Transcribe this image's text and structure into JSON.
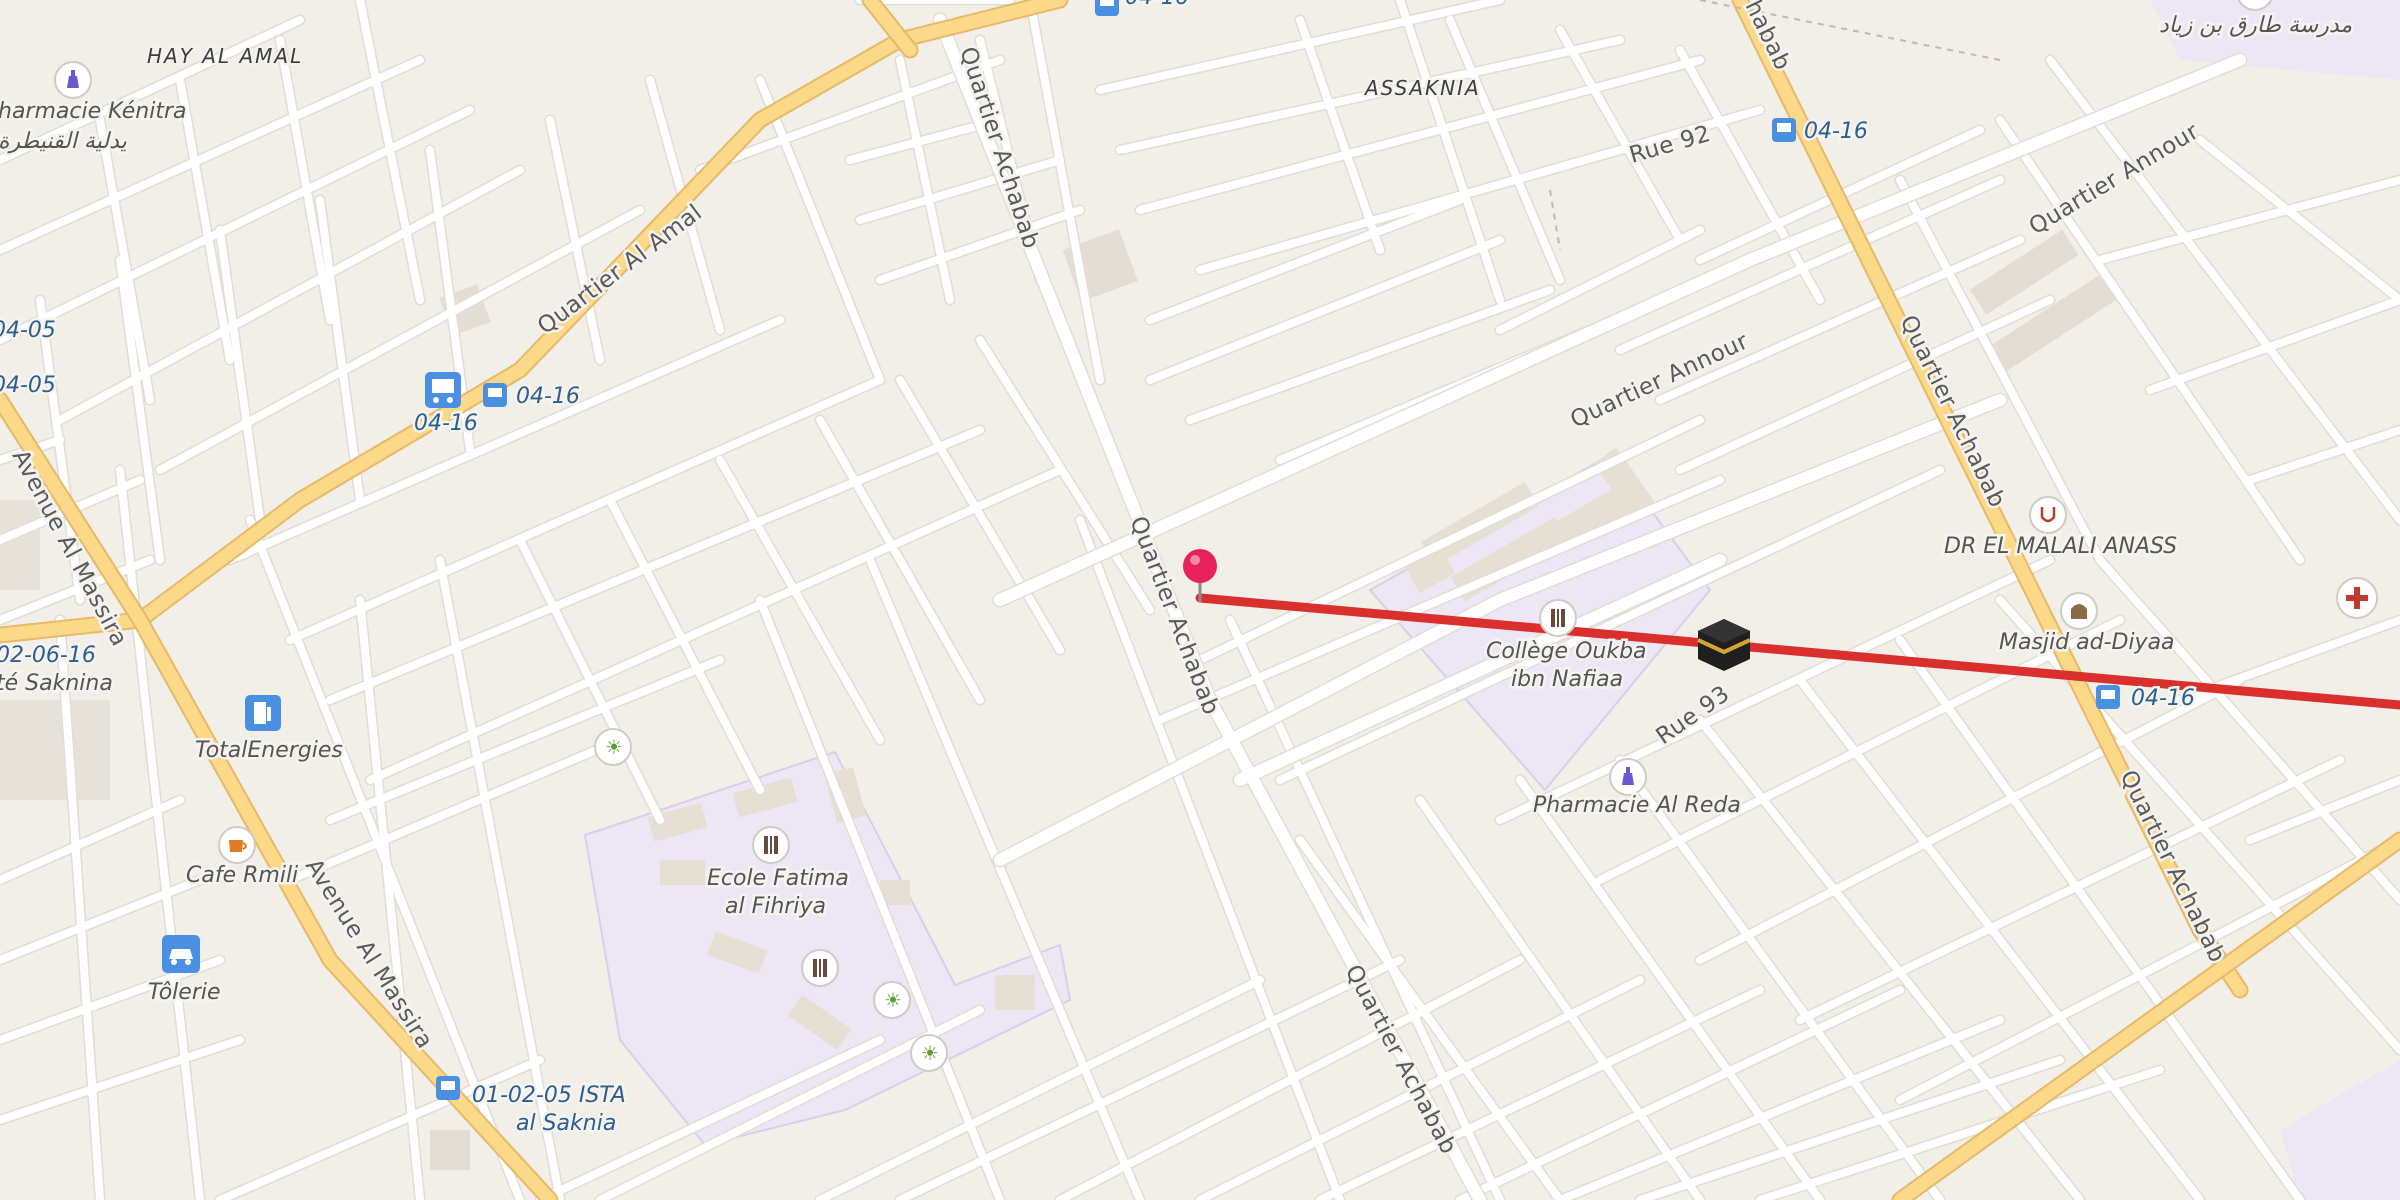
{
  "colors": {
    "background": "#f2efe9",
    "road_minor": "#ffffff",
    "road_main": "#fcd889",
    "school_area": "#ece6f5",
    "route_line": "#d9302e",
    "pin": "#e8215b",
    "bus_icon": "#4a90e2"
  },
  "areas": {
    "hay_al_amal": "HAY AL AMAL",
    "assaknia": "ASSAKNIA"
  },
  "streets": {
    "quartier_al_amal": "Quartier Al Amal",
    "avenue_al_massira_1": "Avenue Al Massira",
    "avenue_al_massira_2": "Avenue Al Massira",
    "quartier_achabab_1": "Quartier Achabab",
    "quartier_achabab_2": "Quartier Achabab",
    "quartier_achabab_3": "Quartier Achabab",
    "quartier_achabab_4": "Quartier Achabab",
    "quartier_achabab_5": "Quartier Achabab",
    "achabab_top": "habab",
    "quartier_annour_1": "Quartier Annour",
    "quartier_annour_2": "Quartier Annour",
    "rue_92": "Rue 92",
    "rue_93": "Rue 93"
  },
  "pois": {
    "pharmacie_kenitra": "harmacie Kénitra",
    "pharmacie_kenitra_ar": "يدلية القنيطرة",
    "madrasa_tariq": "مدرسة طارق بن زياد",
    "total_energies": "TotalEnergies",
    "cafe_rmili": "Cafe Rmili",
    "tolerie": "Tôlerie",
    "ecole_fatima_1": "Ecole Fatima",
    "ecole_fatima_2": "al Fihriya",
    "college_oukba_1": "Collège Oukba",
    "college_oukba_2": "ibn Nafiaa",
    "pharmacie_al_reda": "Pharmacie Al Reda",
    "dr_el_malali": "DR EL MALALI ANASS",
    "masjid_ad_diyaa": "Masjid ad-Diyaa",
    "cite_saknina": "té Saknina"
  },
  "bus_stops": {
    "top_center": "04-16",
    "right_top": "04-16",
    "left_a": "04-05",
    "left_b": "04-05",
    "left_c": "04-16",
    "left_d": "04-16",
    "left_e": "02-06-16",
    "ista_1": "01-02-05 ISTA",
    "ista_2": "al Saknia",
    "right_mid": "04-16"
  },
  "icons": {
    "pin": "map-pin-icon",
    "kaaba": "kaaba-icon",
    "bus": "bus-stop-icon",
    "fuel": "fuel-station-icon",
    "cafe": "cafe-icon",
    "car_repair": "car-repair-icon",
    "school": "school-icon",
    "sport": "sports-icon",
    "pharmacy": "pharmacy-icon",
    "doctor": "doctor-icon",
    "mosque": "mosque-icon",
    "hospital": "hospital-icon"
  }
}
